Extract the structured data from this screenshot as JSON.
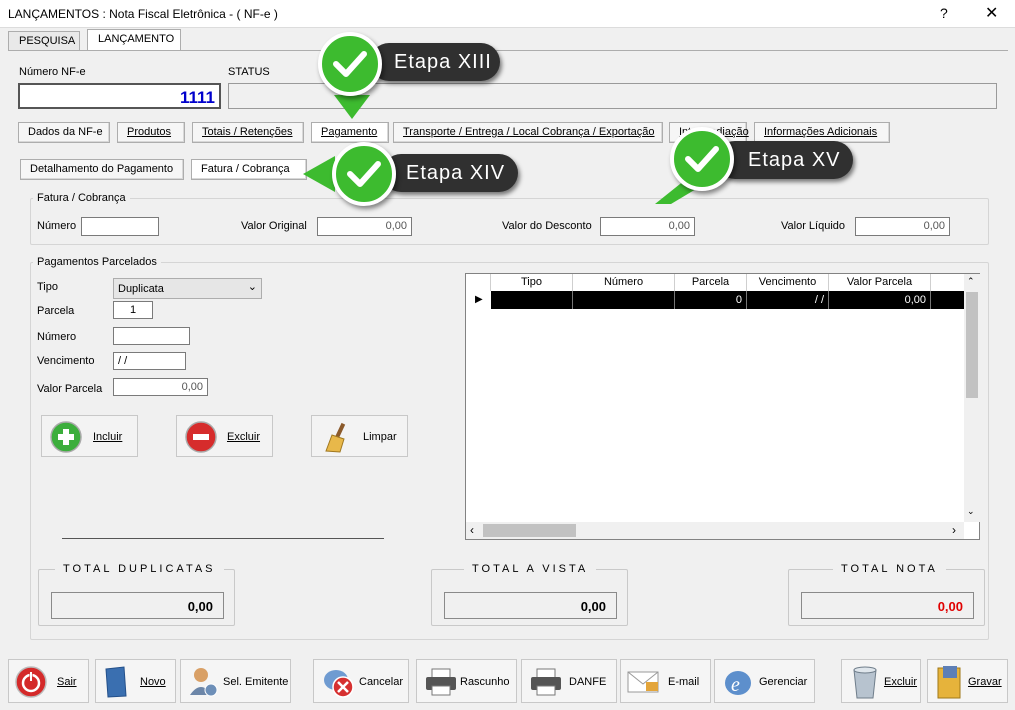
{
  "window": {
    "title": "LANÇAMENTOS : Nota Fiscal Eletrônica - ( NF-e )",
    "help": "?",
    "close": "✕"
  },
  "top_tabs": [
    "PESQUISA",
    "LANÇAMENTO"
  ],
  "header": {
    "numero_label": "Número NF-e",
    "numero_value": "1111",
    "status_label": "STATUS",
    "status_value": ""
  },
  "main_tabs": [
    "Dados da NF-e",
    "Produtos",
    "Totais / Retenções",
    "Pagamento",
    "Transporte / Entrega / Local Cobrança / Exportação",
    "Intermediação",
    "Informações Adicionais"
  ],
  "sub_tabs": [
    "Detalhamento do Pagamento",
    "Fatura / Cobrança"
  ],
  "fatura": {
    "group_title": "Fatura / Cobrança",
    "numero_label": "Número",
    "numero_value": "",
    "valor_original_label": "Valor Original",
    "valor_original_value": "0,00",
    "valor_desconto_label": "Valor do Desconto",
    "valor_desconto_value": "0,00",
    "valor_liquido_label": "Valor Líquido",
    "valor_liquido_value": "0,00"
  },
  "parcelados": {
    "group_title": "Pagamentos Parcelados",
    "tipo_label": "Tipo",
    "tipo_value": "Duplicata",
    "parcela_label": "Parcela",
    "parcela_value": "1",
    "numero_label": "Número",
    "numero_value": "",
    "vencimento_label": "Vencimento",
    "vencimento_value": "/ /",
    "valor_parcela_label": "Valor Parcela",
    "valor_parcela_value": "0,00"
  },
  "actions": {
    "incluir": "Incluir",
    "excluir": "Excluir",
    "limpar": "Limpar"
  },
  "grid": {
    "columns": [
      "Tipo",
      "Número",
      "Parcela",
      "Vencimento",
      "Valor Parcela"
    ],
    "rows": [
      [
        "",
        "",
        "0",
        "/ /",
        "0,00"
      ]
    ]
  },
  "totals": {
    "duplicatas_label": "TOTAL DUPLICATAS",
    "duplicatas_value": "0,00",
    "avista_label": "TOTAL A VISTA",
    "avista_value": "0,00",
    "nota_label": "TOTAL NOTA",
    "nota_value": "0,00"
  },
  "bottom_buttons": [
    "Sair",
    "Novo",
    "Sel. Emitente",
    "Cancelar",
    "Rascunho",
    "DANFE",
    "E-mail",
    "Gerenciar",
    "Excluir",
    "Gravar"
  ],
  "callouts": [
    "Etapa XIII",
    "Etapa XIV",
    "Etapa XV"
  ],
  "colors": {
    "accent_blue": "#0000cc",
    "total_red": "#e00000",
    "check_green": "#3dbb2f",
    "callout_bg": "#303030"
  }
}
